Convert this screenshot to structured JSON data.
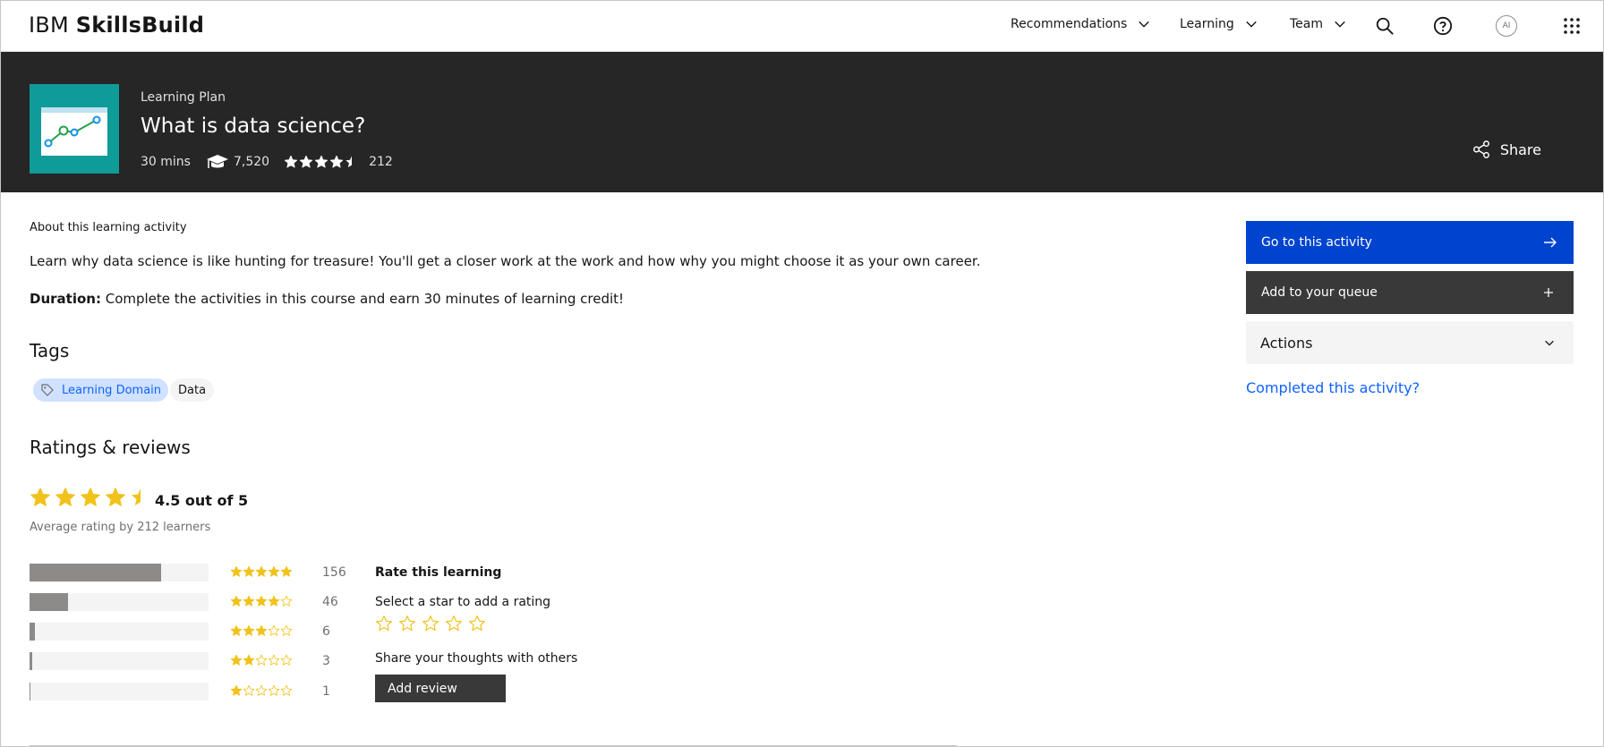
{
  "header": {
    "brand_ibm": "IBM",
    "brand_product": "SkillsBuild",
    "nav": [
      "Recommendations",
      "Learning",
      "Team"
    ],
    "icons": [
      "search-icon",
      "help-icon",
      "avatar",
      "app-switcher-icon"
    ],
    "avatar_initials": "AI"
  },
  "hero": {
    "eyebrow": "Learning Plan",
    "title": "What is data science?",
    "duration": "30 mins",
    "enrolled": "7,520",
    "rating_stars": 4.5,
    "rating_count": "212",
    "share_label": "Share"
  },
  "about": {
    "heading": "About this learning activity",
    "description": "Learn why data science is like hunting for treasure! You'll get a closer work at the work and how why you might choose it as your own career.",
    "duration_label": "Duration:",
    "duration_text": " Complete the activities in this course and earn 30 minutes of learning credit!"
  },
  "tags": {
    "heading": "Tags",
    "items": [
      "Learning Domain",
      "Data"
    ]
  },
  "ratings": {
    "heading": "Ratings & reviews",
    "average": 4.5,
    "out_of_text": "4.5 out of 5",
    "average_caption": "Average rating by 212 learners",
    "distribution": [
      {
        "stars": 5,
        "count": "156",
        "fraction": 0.736
      },
      {
        "stars": 4,
        "count": "46",
        "fraction": 0.217
      },
      {
        "stars": 3,
        "count": "6",
        "fraction": 0.028
      },
      {
        "stars": 2,
        "count": "3",
        "fraction": 0.014
      },
      {
        "stars": 1,
        "count": "1",
        "fraction": 0.005
      }
    ],
    "rate_heading": "Rate this learning",
    "rate_instruction": "Select a star to add a rating",
    "share_thoughts": "Share your thoughts with others",
    "add_review_label": "Add review"
  },
  "actions": {
    "go_label": "Go to this activity",
    "queue_label": "Add to your queue",
    "actions_label": "Actions",
    "completed_link": "Completed this activity?"
  },
  "colors": {
    "star": "#f1c21b",
    "primary": "#0043ce",
    "dark_button": "#393939",
    "hero_bg": "#262626",
    "thumb_bg": "#0f9b98",
    "link": "#0f62fe",
    "tag_bg": "#d0e2ff",
    "bar_fill": "#8d8a8a"
  }
}
